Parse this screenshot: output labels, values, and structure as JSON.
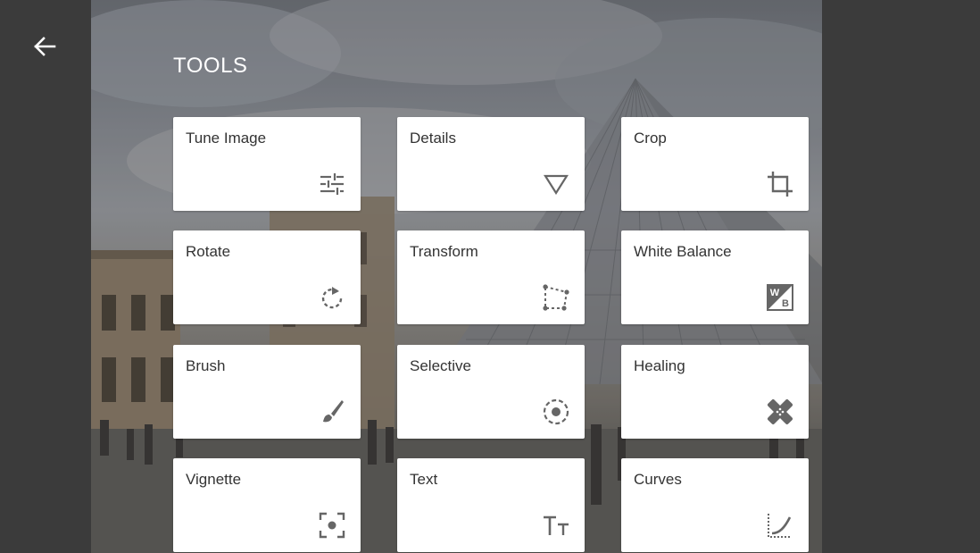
{
  "screen": {
    "title": "TOOLS",
    "back_icon": "arrow-left-icon"
  },
  "tools": [
    {
      "label": "Tune Image",
      "icon": "sliders-icon"
    },
    {
      "label": "Details",
      "icon": "triangle-down-icon"
    },
    {
      "label": "Crop",
      "icon": "crop-icon"
    },
    {
      "label": "Rotate",
      "icon": "rotate-icon"
    },
    {
      "label": "Transform",
      "icon": "perspective-icon"
    },
    {
      "label": "White Balance",
      "icon": "white-balance-icon"
    },
    {
      "label": "Brush",
      "icon": "brush-icon"
    },
    {
      "label": "Selective",
      "icon": "selective-icon"
    },
    {
      "label": "Healing",
      "icon": "bandage-icon"
    },
    {
      "label": "Vignette",
      "icon": "vignette-icon"
    },
    {
      "label": "Text",
      "icon": "text-size-icon"
    },
    {
      "label": "Curves",
      "icon": "curves-icon"
    }
  ]
}
